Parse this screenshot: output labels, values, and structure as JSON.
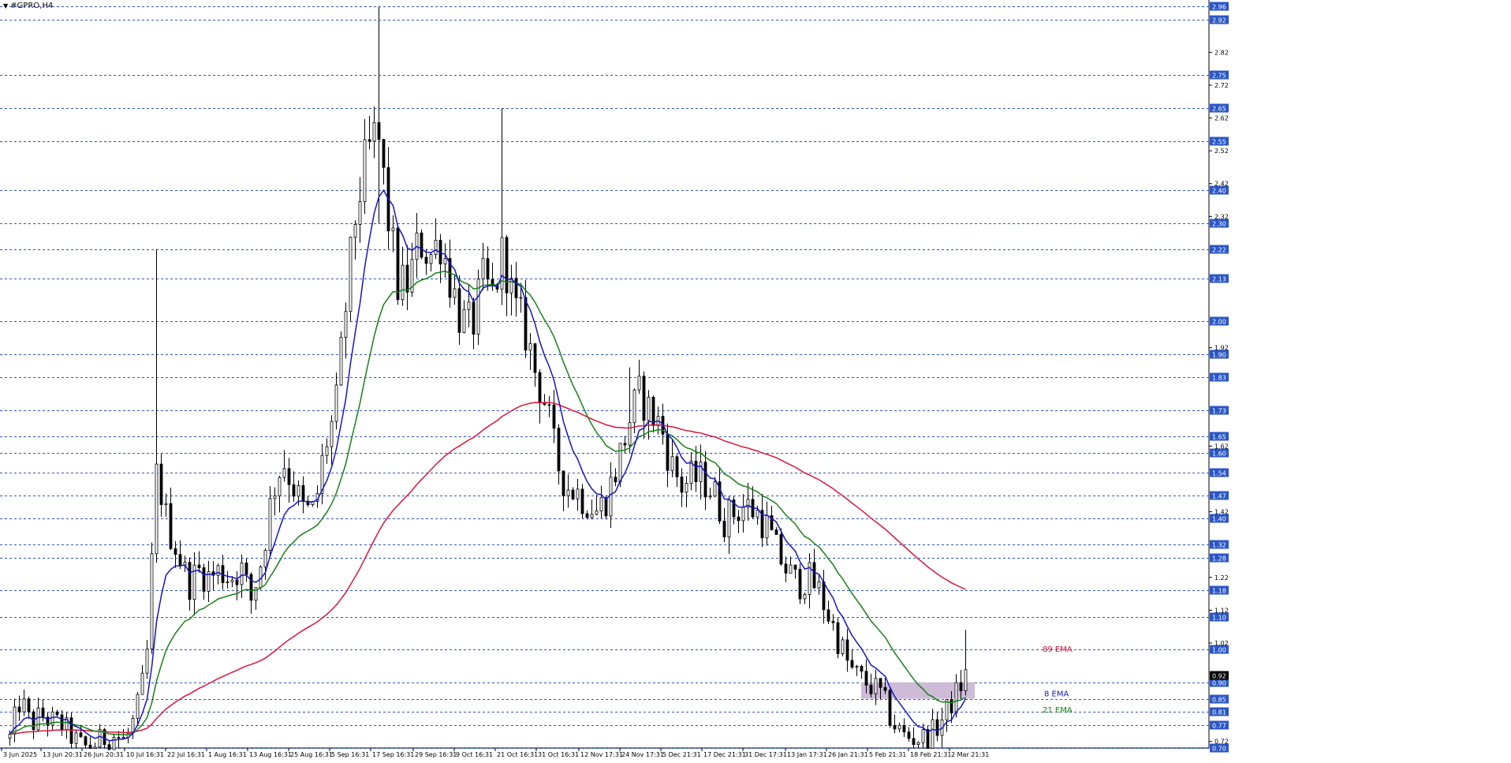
{
  "chart_title": "#GPRO,H4",
  "colors": {
    "grid": "#2a56c6",
    "price_tag_bg": "#2a56c6",
    "price_tag_text": "#ffffff",
    "candle": "#000000",
    "ema8": "#1515c8",
    "ema21": "#158215",
    "ema89": "#dc143c",
    "zone": "#c8b4d4",
    "current_tag_bg": "#000000"
  },
  "chart_data": {
    "type": "candlestick",
    "symbol": "#GPRO",
    "timeframe": "H4",
    "x_labels": [
      "3 Jun 2025",
      "13 Jun 20:31",
      "26 Jun 20:31",
      "10 Jul 16:31",
      "22 Jul 16:31",
      "1 Aug 16:31",
      "13 Aug 16:31",
      "25 Aug 16:31",
      "5 Sep 16:31",
      "17 Sep 16:31",
      "29 Sep 16:31",
      "9 Oct 16:31",
      "21 Oct 16:31",
      "31 Oct 16:31",
      "12 Nov 17:31",
      "24 Nov 17:31",
      "5 Dec 21:31",
      "17 Dec 21:31",
      "31 Dec 17:31",
      "13 Jan 17:31",
      "26 Jan 21:31",
      "5 Feb 21:31",
      "18 Feb 21:31",
      "2 Mar 21:31"
    ],
    "y_ticks": [
      2.82,
      2.72,
      2.62,
      2.52,
      2.42,
      2.32,
      1.92,
      1.62,
      1.42,
      1.22,
      1.12,
      1.02,
      0.72
    ],
    "horizontal_levels": [
      2.96,
      2.92,
      2.75,
      2.65,
      2.55,
      2.4,
      2.3,
      2.22,
      2.13,
      2.0,
      1.9,
      1.83,
      1.73,
      1.65,
      1.6,
      1.54,
      1.47,
      1.4,
      1.32,
      1.28,
      1.18,
      1.1,
      1.0,
      0.9,
      0.85,
      0.81,
      0.77,
      0.7
    ],
    "current_price": "0.92",
    "ylim": [
      0.7,
      2.97
    ],
    "price_path": [
      [
        0,
        0.73
      ],
      [
        1,
        0.85
      ],
      [
        2,
        0.77
      ],
      [
        3,
        0.8
      ],
      [
        4,
        0.78
      ],
      [
        5,
        0.77
      ],
      [
        6,
        0.73
      ],
      [
        7,
        0.7
      ],
      [
        8,
        0.71
      ],
      [
        9,
        0.73
      ],
      [
        10,
        0.74
      ],
      [
        11,
        0.72
      ],
      [
        12,
        0.8
      ],
      [
        13,
        0.95
      ],
      [
        14,
        1.55
      ],
      [
        15,
        1.38
      ],
      [
        16,
        1.3
      ],
      [
        17,
        1.2
      ],
      [
        18,
        1.24
      ],
      [
        19,
        1.22
      ],
      [
        20,
        1.24
      ],
      [
        21,
        1.22
      ],
      [
        22,
        1.25
      ],
      [
        23,
        1.15
      ],
      [
        24,
        1.28
      ],
      [
        25,
        1.48
      ],
      [
        26,
        1.58
      ],
      [
        27,
        1.5
      ],
      [
        28,
        1.42
      ],
      [
        29,
        1.42
      ],
      [
        30,
        1.62
      ],
      [
        31,
        1.72
      ],
      [
        32,
        2.05
      ],
      [
        33,
        2.35
      ],
      [
        34,
        2.5
      ],
      [
        35,
        2.58
      ],
      [
        36,
        2.32
      ],
      [
        37,
        2.1
      ],
      [
        38,
        2.12
      ],
      [
        39,
        2.25
      ],
      [
        40,
        2.2
      ],
      [
        41,
        2.25
      ],
      [
        42,
        2.12
      ],
      [
        43,
        2.0
      ],
      [
        44,
        1.98
      ],
      [
        45,
        2.12
      ],
      [
        46,
        2.08
      ],
      [
        47,
        2.22
      ],
      [
        48,
        2.04
      ],
      [
        49,
        1.98
      ],
      [
        50,
        1.85
      ],
      [
        51,
        1.75
      ],
      [
        52,
        1.58
      ],
      [
        53,
        1.5
      ],
      [
        54,
        1.48
      ],
      [
        55,
        1.45
      ],
      [
        56,
        1.42
      ],
      [
        57,
        1.48
      ],
      [
        58,
        1.58
      ],
      [
        59,
        1.7
      ],
      [
        60,
        1.78
      ],
      [
        61,
        1.72
      ],
      [
        62,
        1.68
      ],
      [
        63,
        1.56
      ],
      [
        64,
        1.5
      ],
      [
        65,
        1.52
      ],
      [
        66,
        1.52
      ],
      [
        67,
        1.48
      ],
      [
        68,
        1.4
      ],
      [
        69,
        1.42
      ],
      [
        70,
        1.44
      ],
      [
        71,
        1.42
      ],
      [
        72,
        1.38
      ],
      [
        73,
        1.3
      ],
      [
        74,
        1.24
      ],
      [
        75,
        1.2
      ],
      [
        76,
        1.22
      ],
      [
        77,
        1.18
      ],
      [
        78,
        1.1
      ],
      [
        79,
        1.02
      ],
      [
        80,
        0.94
      ],
      [
        81,
        0.91
      ],
      [
        82,
        0.89
      ],
      [
        83,
        0.86
      ],
      [
        84,
        0.78
      ],
      [
        85,
        0.74
      ],
      [
        86,
        0.73
      ],
      [
        87,
        0.73
      ],
      [
        88,
        0.75
      ],
      [
        89,
        0.8
      ],
      [
        90,
        0.86
      ],
      [
        91,
        0.92
      ]
    ],
    "spikes": [
      {
        "i": 14,
        "high": 2.22,
        "low": 1.35
      },
      {
        "i": 35,
        "high": 2.96,
        "low": 2.3
      },
      {
        "i": 47,
        "high": 2.65,
        "low": 2.05
      },
      {
        "i": 59,
        "high": 1.86,
        "low": 1.6
      },
      {
        "i": 91,
        "high": 1.06,
        "low": 0.86
      }
    ],
    "series": [
      {
        "name": "8 EMA",
        "period": 8
      },
      {
        "name": "21 EMA",
        "period": 21
      },
      {
        "name": "89 EMA",
        "period": 89
      }
    ],
    "annotations": [
      {
        "label": "89 EMA",
        "y": 1.0
      },
      {
        "label": "8 EMA",
        "y": 0.865
      },
      {
        "label": "21 EMA",
        "y": 0.815
      }
    ],
    "zone": {
      "y_low": 0.85,
      "y_high": 0.9,
      "start_index": 81,
      "end_index": 92
    }
  }
}
